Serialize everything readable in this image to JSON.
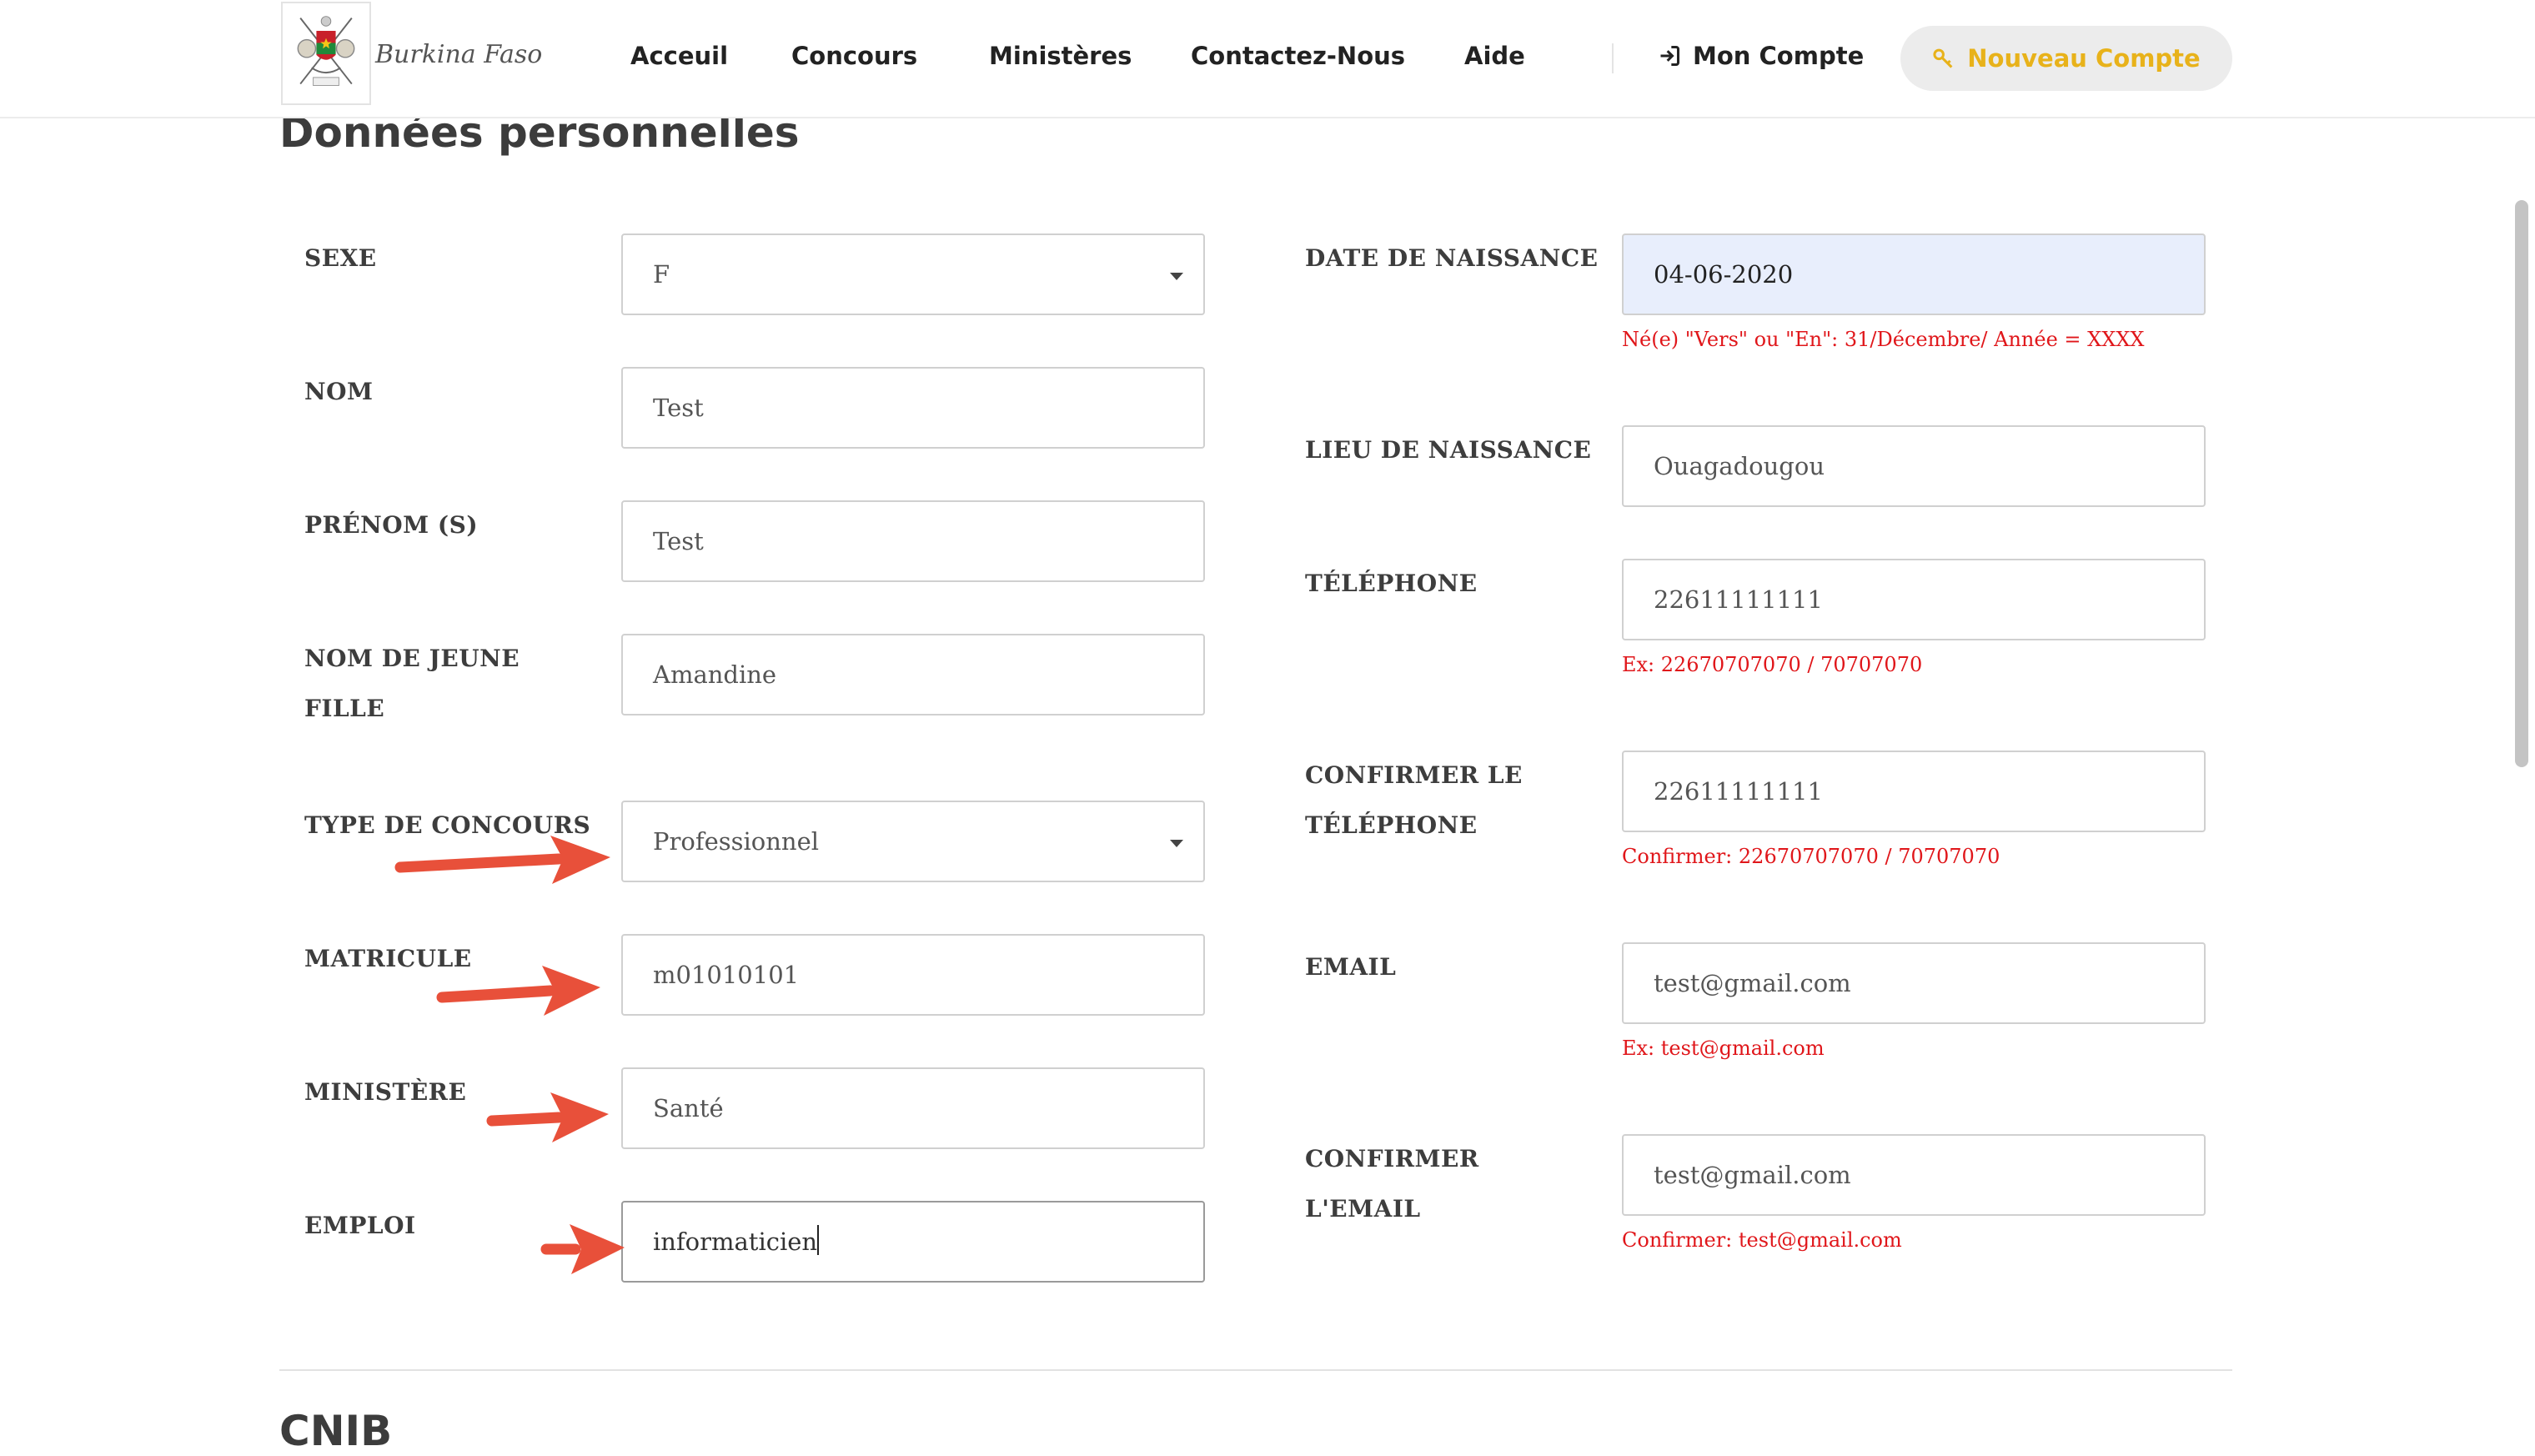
{
  "header": {
    "brand": "Burkina Faso",
    "nav": [
      "Acceuil",
      "Concours",
      "Ministères",
      "Contactez-Nous",
      "Aide"
    ],
    "account_label": "Mon Compte",
    "new_account_label": "Nouveau Compte",
    "new_account_color": "#e8b21a"
  },
  "section": {
    "title": "Données personnelles",
    "next_title": "CNIB"
  },
  "left_fields": {
    "sexe": {
      "label": "SEXE",
      "value": "F"
    },
    "nom": {
      "label": "NOM",
      "value": "Test"
    },
    "prenom": {
      "label": "PRÉNOM (S)",
      "value": "Test"
    },
    "nom_jeune_fille": {
      "label_line1": "NOM DE JEUNE",
      "label_line2": "FILLE",
      "value": "Amandine"
    },
    "type_concours": {
      "label": "TYPE DE CONCOURS",
      "value": "Professionnel"
    },
    "matricule": {
      "label": "MATRICULE",
      "value": "m01010101"
    },
    "ministere": {
      "label": "MINISTÈRE",
      "value": "Santé"
    },
    "emploi": {
      "label": "EMPLOI",
      "value": "informaticien"
    }
  },
  "right_fields": {
    "date_naissance": {
      "label": "DATE DE NAISSANCE",
      "value": "04-06-2020",
      "hint": "Né(e) \"Vers\" ou \"En\": 31/Décembre/ Année = XXXX"
    },
    "lieu_naissance": {
      "label": "LIEU DE NAISSANCE",
      "value": "Ouagadougou"
    },
    "telephone": {
      "label": "TÉLÉPHONE",
      "value": "22611111111",
      "hint": "Ex: 22670707070 / 70707070"
    },
    "confirm_telephone": {
      "label_line1": "CONFIRMER LE",
      "label_line2": "TÉLÉPHONE",
      "value": "22611111111",
      "hint": "Confirmer: 22670707070 / 70707070"
    },
    "email": {
      "label": "EMAIL",
      "value": "test@gmail.com",
      "hint": "Ex: test@gmail.com"
    },
    "confirm_email": {
      "label_line1": "CONFIRMER",
      "label_line2": "L'EMAIL",
      "value": "test@gmail.com",
      "hint": "Confirmer: test@gmail.com"
    }
  },
  "colors": {
    "hint_red": "#e0161a",
    "annotation_arrow": "#e8503a",
    "date_field_bg": "#e8eefc"
  },
  "icons": [
    "coat-of-arms-logo",
    "sign-in-icon",
    "key-icon",
    "caret-down-icon",
    "arrow-annotation"
  ]
}
